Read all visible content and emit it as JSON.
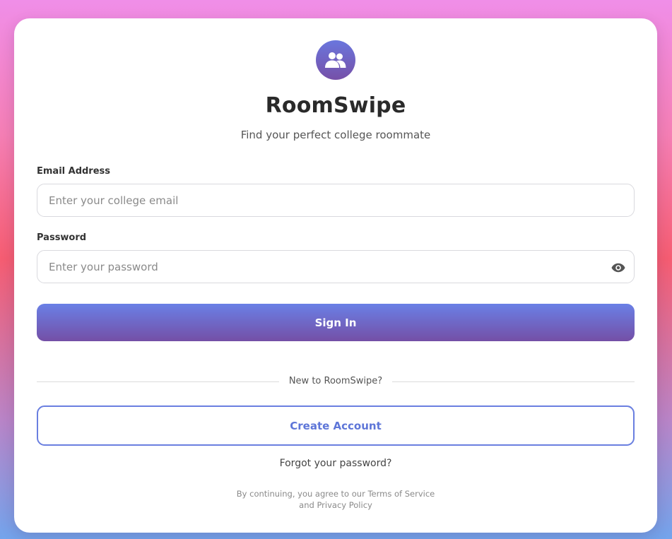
{
  "app": {
    "title": "RoomSwipe",
    "subtitle": "Find your perfect college roommate",
    "logo_icon": "users-icon"
  },
  "form": {
    "email_label": "Email Address",
    "email_placeholder": "Enter your college email",
    "email_value": "",
    "password_label": "Password",
    "password_placeholder": "Enter your password",
    "password_value": "",
    "password_toggle_icon": "eye-icon",
    "sign_in_label": "Sign In"
  },
  "divider": {
    "text": "New to RoomSwipe?"
  },
  "create_account_label": "Create Account",
  "forgot_password_label": "Forgot your password?",
  "terms": {
    "line1": "By continuing, you agree to our Terms of Service",
    "line2": "and Privacy Policy"
  },
  "colors": {
    "accent": "#667eea",
    "accent_dark": "#764ba2",
    "outline_text": "#5e76d8"
  }
}
